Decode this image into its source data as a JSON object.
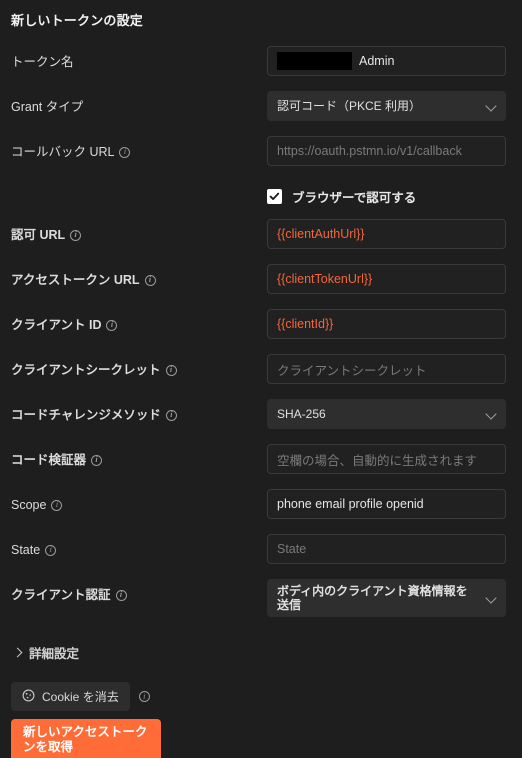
{
  "panel": {
    "title": "新しいトークンの設定"
  },
  "fields": {
    "token_name": {
      "label": "トークン名",
      "redacted": true,
      "value_suffix": "Admin"
    },
    "grant_type": {
      "label": "Grant タイプ",
      "value": "認可コード（PKCE 利用）"
    },
    "callback_url": {
      "label": "コールバック URL",
      "info": "info-icon",
      "placeholder": "https://oauth.pstmn.io/v1/callback",
      "value": ""
    },
    "authorize_browser": {
      "label": "ブラウザーで認可する",
      "checked": true
    },
    "auth_url": {
      "label": "認可 URL",
      "info": "info-icon",
      "value": "{{clientAuthUrl}}"
    },
    "access_token_url": {
      "label": "アクセストークン URL",
      "info": "info-icon",
      "value": "{{clientTokenUrl}}"
    },
    "client_id": {
      "label": "クライアント ID",
      "info": "info-icon",
      "value": "{{clientId}}"
    },
    "client_secret": {
      "label": "クライアントシークレット",
      "info": "info-icon",
      "placeholder": "クライアントシークレット",
      "value": ""
    },
    "code_challenge_method": {
      "label": "コードチャレンジメソッド",
      "info": "info-icon",
      "value": "SHA-256"
    },
    "code_verifier": {
      "label": "コード検証器",
      "info": "info-icon",
      "placeholder": "空欄の場合、自動的に生成されます",
      "value": ""
    },
    "scope": {
      "label": "Scope",
      "info": "info-icon",
      "value": "phone email profile openid"
    },
    "state": {
      "label": "State",
      "info": "info-icon",
      "placeholder": "State",
      "value": ""
    },
    "client_authentication": {
      "label": "クライアント認証",
      "info": "info-icon",
      "value": "ボディ内のクライアント資格情報を送信"
    }
  },
  "advanced": {
    "label": "詳細設定",
    "icon": "chevron-right-icon",
    "expanded": false
  },
  "footer": {
    "clear_cookies_label": "Cookie を消去",
    "clear_cookies_icon": "cookie-icon",
    "clear_cookies_info": "info-icon",
    "get_token_label": "新しいアクセストークンを取得"
  },
  "colors": {
    "background": "#1e1e1e",
    "input_background": "#212121",
    "input_border": "#3a3a3a",
    "select_background": "#2e2e2e",
    "accent_orange": "#ff6c37",
    "variable_orange": "#f2663c",
    "text_primary": "#e8e8e8",
    "text_placeholder": "#7a7a7a",
    "redaction_black": "#000000"
  }
}
